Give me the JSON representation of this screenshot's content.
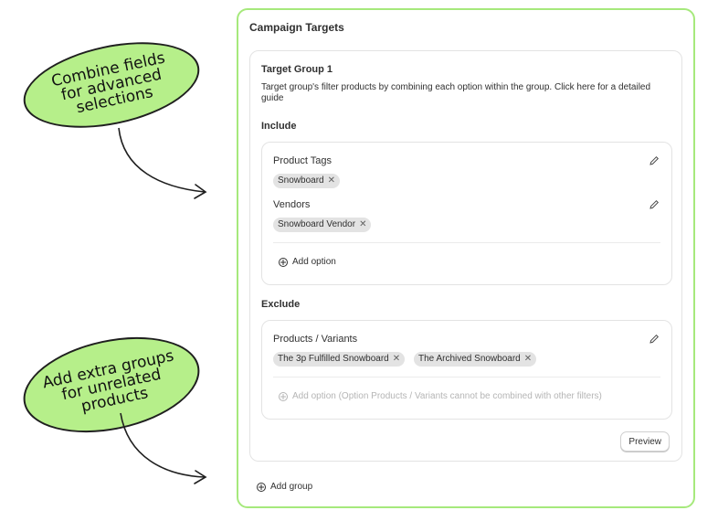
{
  "annotations": {
    "callout_top": "Combine fields\nfor advanced\nselections",
    "callout_bottom": "Add extra groups\nfor unrelated\nproducts"
  },
  "panel": {
    "title": "Campaign Targets",
    "group": {
      "title": "Target Group 1",
      "description": "Target group's filter products by combining each option within the group. Click here for a detailed guide",
      "include": {
        "title": "Include",
        "fields": [
          {
            "label": "Product Tags",
            "chips": [
              "Snowboard"
            ]
          },
          {
            "label": "Vendors",
            "chips": [
              "Snowboard Vendor"
            ]
          }
        ],
        "add_option": "Add option"
      },
      "exclude": {
        "title": "Exclude",
        "fields": [
          {
            "label": "Products / Variants",
            "chips": [
              "The 3p Fulfilled Snowboard",
              "The Archived Snowboard"
            ]
          }
        ],
        "add_option": "Add option (Option Products / Variants cannot be combined with other filters)"
      },
      "preview_button": "Preview"
    },
    "add_group": "Add group"
  },
  "colors": {
    "callout_fill": "#b6ef8a",
    "panel_border": "#a6e97c",
    "chip_bg": "#e3e3e3",
    "disabled_text": "#b5b5b5"
  },
  "icons": [
    "pencil-icon",
    "close-icon",
    "plus-circle-icon",
    "curved-arrow-icon"
  ]
}
